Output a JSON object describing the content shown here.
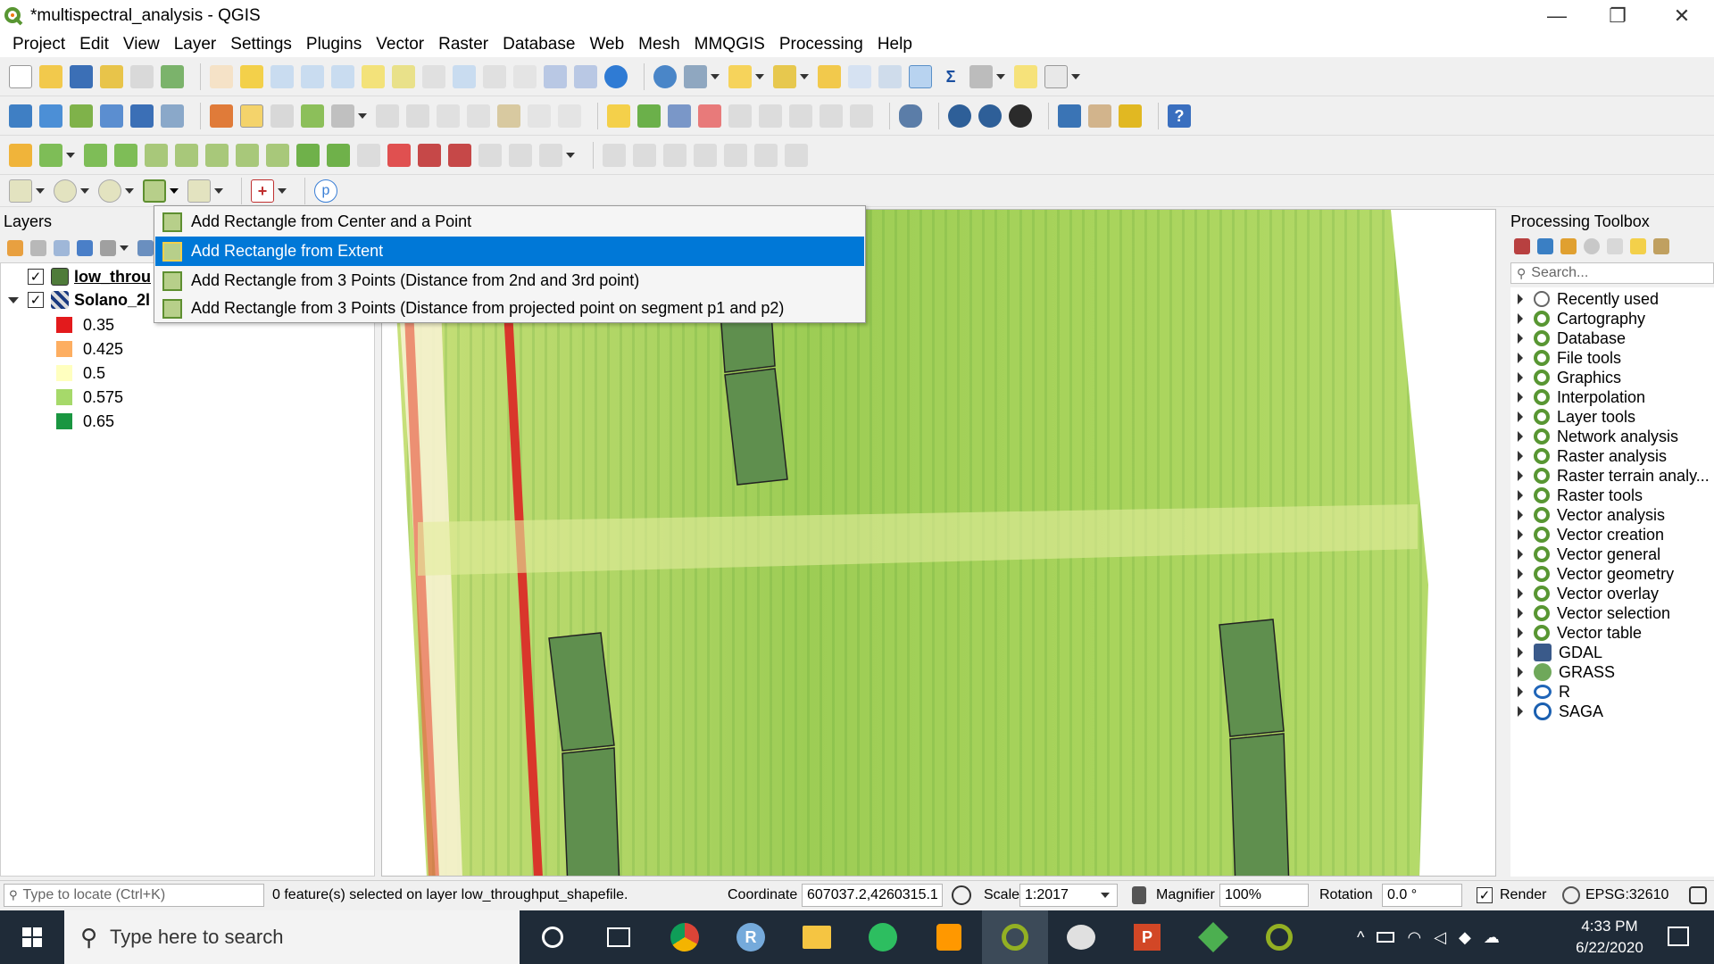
{
  "window": {
    "title": "*multispectral_analysis - QGIS",
    "minimize": "—",
    "restore": "❐",
    "close": "✕"
  },
  "menubar": [
    "Project",
    "Edit",
    "View",
    "Layer",
    "Settings",
    "Plugins",
    "Vector",
    "Raster",
    "Database",
    "Web",
    "Mesh",
    "MMQGIS",
    "Processing",
    "Help"
  ],
  "layers_panel": {
    "title": "Layers",
    "layers": [
      {
        "name": "low_throu",
        "checked": true
      },
      {
        "name": "Solano_2l",
        "checked": true
      }
    ],
    "legend": [
      {
        "label": "0.35",
        "color": "#e31a1c"
      },
      {
        "label": "0.425",
        "color": "#fdae61"
      },
      {
        "label": "0.5",
        "color": "#ffffbf"
      },
      {
        "label": "0.575",
        "color": "#a6d96a"
      },
      {
        "label": "0.65",
        "color": "#1a9641"
      }
    ]
  },
  "dropdown": {
    "items": [
      {
        "label": "Add Rectangle from Center and a Point",
        "selected": false
      },
      {
        "label": "Add Rectangle from Extent",
        "selected": true
      },
      {
        "label": "Add Rectangle from 3 Points (Distance from 2nd and 3rd point)",
        "selected": false
      },
      {
        "label": "Add Rectangle from 3 Points (Distance from projected point on segment p1 and p2)",
        "selected": false
      }
    ]
  },
  "toolbox": {
    "title": "Processing Toolbox",
    "search_placeholder": "Search...",
    "items": [
      "Recently used",
      "Cartography",
      "Database",
      "File tools",
      "Graphics",
      "Interpolation",
      "Layer tools",
      "Network analysis",
      "Raster analysis",
      "Raster terrain analy...",
      "Raster tools",
      "Vector analysis",
      "Vector creation",
      "Vector general",
      "Vector geometry",
      "Vector overlay",
      "Vector selection",
      "Vector table",
      "GDAL",
      "GRASS",
      "R",
      "SAGA"
    ]
  },
  "statusbar": {
    "locate_placeholder": "Type to locate (Ctrl+K)",
    "message": "0 feature(s) selected on layer low_throughput_shapefile.",
    "coordinate_label": "Coordinate",
    "coordinate_value": "607037.2,4260315.1",
    "scale_label": "Scale",
    "scale_value": "1:2017",
    "magnifier_label": "Magnifier",
    "magnifier_value": "100%",
    "rotation_label": "Rotation",
    "rotation_value": "0.0 °",
    "render_label": "Render",
    "crs": "EPSG:32610"
  },
  "taskbar": {
    "search_placeholder": "Type here to search",
    "time": "4:33 PM",
    "date": "6/22/2020"
  }
}
